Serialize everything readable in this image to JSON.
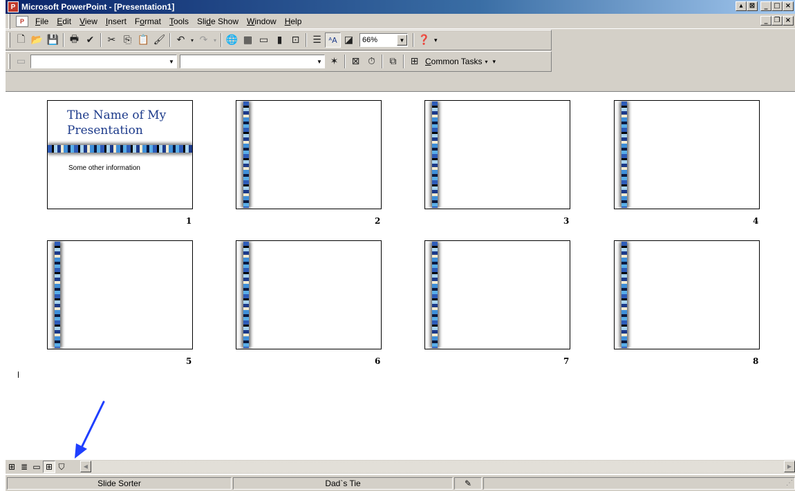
{
  "window": {
    "title": "Microsoft PowerPoint - [Presentation1]",
    "app_icon": "powerpoint-icon",
    "doc_icon": "presentation-doc-icon"
  },
  "menu": {
    "items": [
      {
        "pre": "",
        "ul": "F",
        "post": "ile"
      },
      {
        "pre": "",
        "ul": "E",
        "post": "dit"
      },
      {
        "pre": "",
        "ul": "V",
        "post": "iew"
      },
      {
        "pre": "",
        "ul": "I",
        "post": "nsert"
      },
      {
        "pre": "F",
        "ul": "o",
        "post": "rmat"
      },
      {
        "pre": "",
        "ul": "T",
        "post": "ools"
      },
      {
        "pre": "Sli",
        "ul": "d",
        "post": "e Show"
      },
      {
        "pre": "",
        "ul": "W",
        "post": "indow"
      },
      {
        "pre": "",
        "ul": "H",
        "post": "elp"
      }
    ]
  },
  "toolbar": {
    "zoom_value": "66%",
    "common_tasks_ul": "C",
    "common_tasks_rest": "ommon Tasks"
  },
  "slides": [
    {
      "number": "1",
      "title": "The Name of My Presentation",
      "subtitle": "Some other information"
    },
    {
      "number": "2"
    },
    {
      "number": "3"
    },
    {
      "number": "4"
    },
    {
      "number": "5"
    },
    {
      "number": "6"
    },
    {
      "number": "7"
    },
    {
      "number": "8"
    }
  ],
  "status": {
    "view": "Slide Sorter",
    "design": "Dad`s Tie"
  },
  "colors": {
    "title_bar": "#0a246a",
    "chrome": "#d4d0c8",
    "annotation_arrow": "#1f3fff"
  }
}
